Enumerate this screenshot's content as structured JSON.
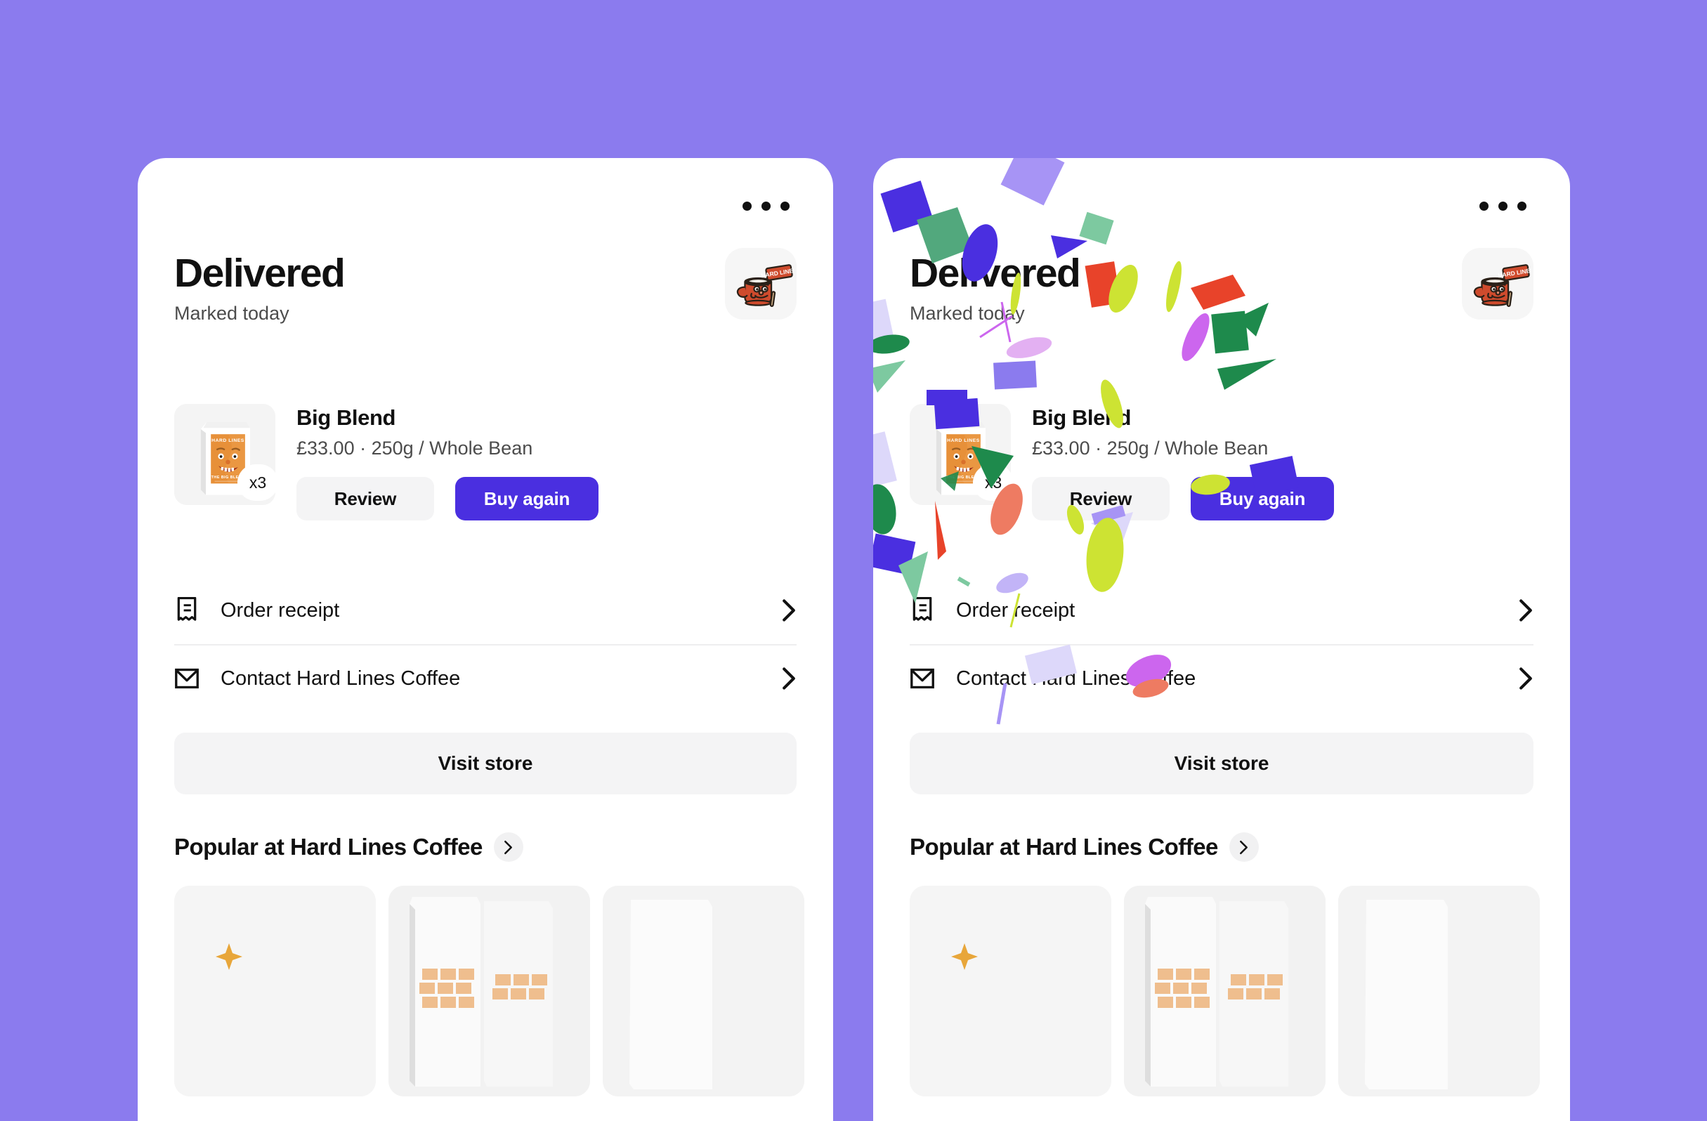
{
  "background_color": "#8B7BEE",
  "accent_color": "#4A2FE0",
  "cards": [
    {
      "id": "order-card-plain",
      "confetti": false,
      "menu_icon": "kebab-menu-icon",
      "status_title": "Delivered",
      "status_subtitle": "Marked today",
      "store_avatar_icon": "hard-lines-mug-mascot-icon",
      "product": {
        "name": "Big Blend",
        "meta": "£33.00 · 250g / Whole Bean",
        "price": "£33.00",
        "variant": "250g / Whole Bean",
        "quantity_badge": "x3",
        "image_label_brand": "HARD LINES",
        "image_label_name": "THE BIG BLEND",
        "review_label": "Review",
        "buy_again_label": "Buy again"
      },
      "rows": [
        {
          "icon": "receipt-icon",
          "label": "Order receipt",
          "chevron": "chevron-right-icon"
        },
        {
          "icon": "envelope-icon",
          "label": "Contact Hard Lines Coffee",
          "chevron": "chevron-right-icon"
        }
      ],
      "visit_store_label": "Visit store",
      "popular_heading": "Popular at Hard Lines Coffee",
      "popular_chevron_icon": "chevron-right-icon",
      "tiles": [
        {
          "name": "sparkle-tile",
          "icon": "sparkle-icon"
        },
        {
          "name": "coffee-bags-tile",
          "icon": "coffee-bags-image"
        },
        {
          "name": "partial-tile",
          "icon": "coffee-bag-image"
        }
      ]
    },
    {
      "id": "order-card-confetti",
      "confetti": true,
      "menu_icon": "kebab-menu-icon",
      "status_title": "Delivered",
      "status_subtitle": "Marked today",
      "store_avatar_icon": "hard-lines-mug-mascot-icon",
      "product": {
        "name": "Big Blend",
        "meta": "£33.00 · 250g / Whole Bean",
        "price": "£33.00",
        "variant": "250g / Whole Bean",
        "quantity_badge": "x3",
        "image_label_brand": "HARD LINES",
        "image_label_name": "THE BIG BLEND",
        "review_label": "Review",
        "buy_again_label": "Buy again"
      },
      "rows": [
        {
          "icon": "receipt-icon",
          "label": "Order receipt",
          "chevron": "chevron-right-icon"
        },
        {
          "icon": "envelope-icon",
          "label": "Contact Hard Lines Coffee",
          "chevron": "chevron-right-icon"
        }
      ],
      "visit_store_label": "Visit store",
      "popular_heading": "Popular at Hard Lines Coffee",
      "popular_chevron_icon": "chevron-right-icon",
      "tiles": [
        {
          "name": "sparkle-tile",
          "icon": "sparkle-icon"
        },
        {
          "name": "coffee-bags-tile",
          "icon": "coffee-bags-image"
        },
        {
          "name": "partial-tile",
          "icon": "coffee-bag-image"
        }
      ]
    }
  ],
  "confetti_palette": {
    "indigo": "#4A2FE0",
    "lavender": "#A794F5",
    "pale_lavender": "#DDD8FA",
    "green": "#1E8A4C",
    "mint": "#7DC9A0",
    "lime": "#CDE333",
    "red": "#E8432A",
    "salmon": "#EE7B62",
    "magenta": "#CC66EE",
    "pink": "#E3B0F2"
  }
}
